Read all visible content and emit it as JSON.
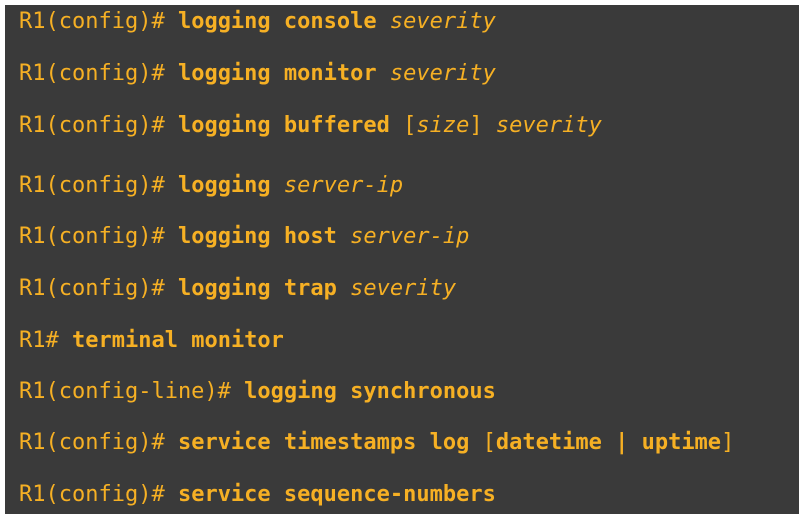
{
  "colors": {
    "panel_background": "#3a3a3a",
    "text": "#f6b024",
    "page_background": "#ffffff"
  },
  "commands": [
    {
      "prompt": "R1(config)#",
      "keyword": "logging console",
      "argument": "severity"
    },
    {
      "prompt": "R1(config)#",
      "keyword": "logging monitor",
      "argument": "severity"
    },
    {
      "prompt": "R1(config)#",
      "keyword": "logging buffered",
      "open_bracket": "[",
      "optional": "size",
      "close_bracket": "]",
      "argument": "severity"
    },
    {
      "prompt": "R1(config)#",
      "keyword": "logging",
      "argument": "server-ip"
    },
    {
      "prompt": "R1(config)#",
      "keyword": "logging host",
      "argument": "server-ip"
    },
    {
      "prompt": "R1(config)#",
      "keyword": "logging trap",
      "argument": "severity"
    },
    {
      "prompt": "R1#",
      "keyword": "terminal monitor"
    },
    {
      "prompt": "R1(config-line)#",
      "keyword": "logging synchronous"
    },
    {
      "prompt": "R1(config)#",
      "keyword": "service timestamps log",
      "open_bracket": "[",
      "choice_a": "datetime",
      "separator": "|",
      "choice_b": "uptime",
      "close_bracket": "]"
    },
    {
      "prompt": "R1(config)#",
      "keyword": "service sequence-numbers"
    }
  ]
}
